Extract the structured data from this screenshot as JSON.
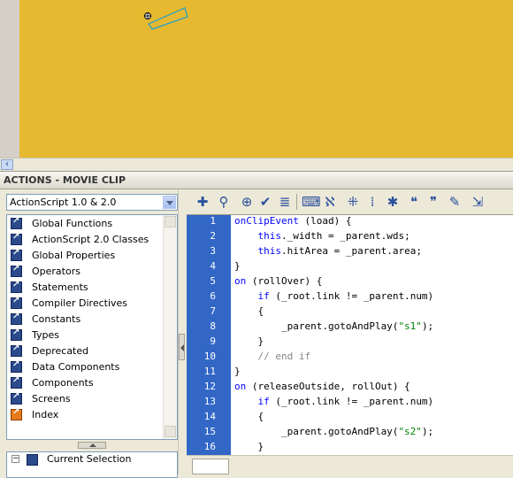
{
  "panel": {
    "title": "ACTIONS - MOVIE CLIP"
  },
  "version_select": {
    "value": "ActionScript 1.0 & 2.0"
  },
  "toolbox": {
    "items": [
      {
        "label": "Global Functions",
        "icon": "book-icon"
      },
      {
        "label": "ActionScript 2.0 Classes",
        "icon": "book-icon"
      },
      {
        "label": "Global Properties",
        "icon": "book-icon"
      },
      {
        "label": "Operators",
        "icon": "book-icon"
      },
      {
        "label": "Statements",
        "icon": "book-icon"
      },
      {
        "label": "Compiler Directives",
        "icon": "book-icon"
      },
      {
        "label": "Constants",
        "icon": "book-icon"
      },
      {
        "label": "Types",
        "icon": "book-icon"
      },
      {
        "label": "Deprecated",
        "icon": "book-icon"
      },
      {
        "label": "Data Components",
        "icon": "book-icon"
      },
      {
        "label": "Components",
        "icon": "book-icon"
      },
      {
        "label": "Screens",
        "icon": "book-icon"
      },
      {
        "label": "Index",
        "icon": "index-icon"
      }
    ]
  },
  "script_nav": {
    "current_selection": "Current Selection"
  },
  "toolbar": {
    "icons": [
      "add-statement-icon",
      "find-icon",
      "insert-target-path-icon",
      "check-syntax-icon",
      "auto-format-icon",
      "show-code-hint-icon",
      "debug-options-icon",
      "collapse-between-braces-icon",
      "collapse-selection-icon",
      "expand-all-icon",
      "apply-block-comment-icon",
      "apply-line-comment-icon",
      "remove-comment-icon",
      "show-hide-toolbox-icon"
    ]
  },
  "code": {
    "lines": [
      {
        "n": "1",
        "text": "onClipEvent (load) {"
      },
      {
        "n": "2",
        "text": "    this._width = _parent.wds;"
      },
      {
        "n": "3",
        "text": "    this.hitArea = _parent.area;"
      },
      {
        "n": "4",
        "text": "}"
      },
      {
        "n": "5",
        "text": "on (rollOver) {"
      },
      {
        "n": "6",
        "text": "    if (_root.link != _parent.num)"
      },
      {
        "n": "7",
        "text": "    {"
      },
      {
        "n": "8",
        "text": "        _parent.gotoAndPlay(\"s1\");"
      },
      {
        "n": "9",
        "text": "    }"
      },
      {
        "n": "10",
        "text": "    // end if"
      },
      {
        "n": "11",
        "text": "}"
      },
      {
        "n": "12",
        "text": "on (releaseOutside, rollOut) {"
      },
      {
        "n": "13",
        "text": "    if (_root.link != _parent.num)"
      },
      {
        "n": "14",
        "text": "    {"
      },
      {
        "n": "15",
        "text": "        _parent.gotoAndPlay(\"s2\");"
      },
      {
        "n": "16",
        "text": "    }"
      }
    ]
  },
  "colors": {
    "stage": "#e6b931",
    "gutter": "#3267c6",
    "keyword": "#0000ff",
    "string": "#008000",
    "comment": "#858585"
  }
}
